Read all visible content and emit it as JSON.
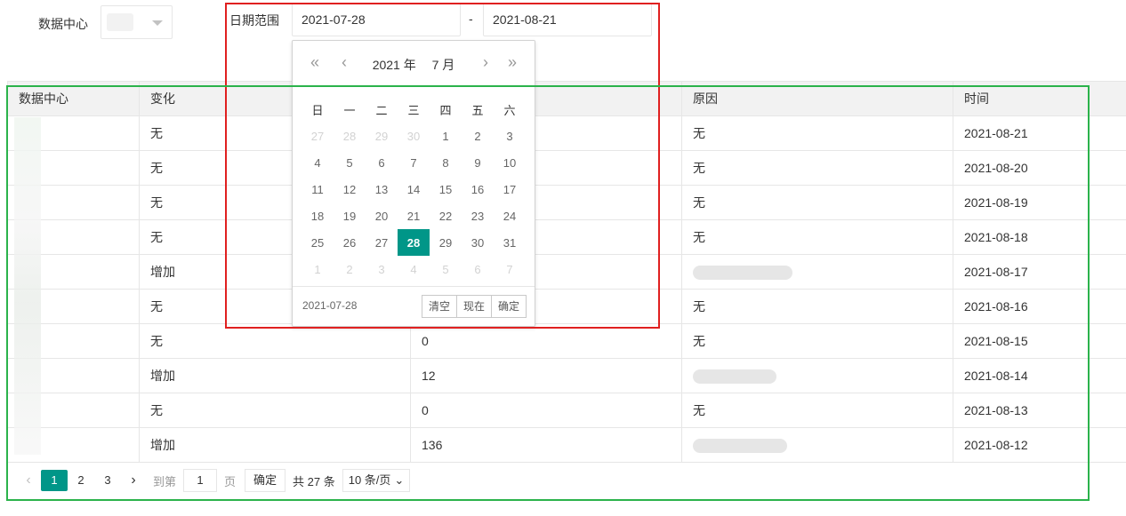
{
  "filters": {
    "datacenter_label": "数据中心",
    "range_label": "日期范围",
    "start_date": "2021-07-28",
    "separator": "-",
    "end_date": "2021-08-21"
  },
  "table": {
    "headers": [
      "数据中心",
      "变化",
      "",
      "原因",
      "时间"
    ],
    "rows": [
      {
        "change": "无",
        "count": "",
        "reason": "无",
        "time": "2021-08-21"
      },
      {
        "change": "无",
        "count": "",
        "reason": "无",
        "time": "2021-08-20"
      },
      {
        "change": "无",
        "count": "",
        "reason": "无",
        "time": "2021-08-19"
      },
      {
        "change": "无",
        "count": "",
        "reason": "无",
        "time": "2021-08-18"
      },
      {
        "change": "增加",
        "count": "",
        "reason": "",
        "time": "2021-08-17"
      },
      {
        "change": "无",
        "count": "",
        "reason": "无",
        "time": "2021-08-16"
      },
      {
        "change": "无",
        "count": "0",
        "reason": "无",
        "time": "2021-08-15"
      },
      {
        "change": "增加",
        "count": "12",
        "reason": "",
        "time": "2021-08-14"
      },
      {
        "change": "无",
        "count": "0",
        "reason": "无",
        "time": "2021-08-13"
      },
      {
        "change": "增加",
        "count": "136",
        "reason": "",
        "time": "2021-08-12"
      }
    ]
  },
  "pagination": {
    "pages": [
      "1",
      "2",
      "3"
    ],
    "goto_label": "到第",
    "goto_value": "1",
    "page_label": "页",
    "confirm": "确定",
    "total": "共 27 条",
    "page_size": "10 条/页"
  },
  "picker": {
    "year": "2021 年",
    "month": "7 月",
    "weekdays": [
      "日",
      "一",
      "二",
      "三",
      "四",
      "五",
      "六"
    ],
    "weeks": [
      [
        "27",
        "28",
        "29",
        "30",
        "1",
        "2",
        "3"
      ],
      [
        "4",
        "5",
        "6",
        "7",
        "8",
        "9",
        "10"
      ],
      [
        "11",
        "12",
        "13",
        "14",
        "15",
        "16",
        "17"
      ],
      [
        "18",
        "19",
        "20",
        "21",
        "22",
        "23",
        "24"
      ],
      [
        "25",
        "26",
        "27",
        "28",
        "29",
        "30",
        "31"
      ],
      [
        "1",
        "2",
        "3",
        "4",
        "5",
        "6",
        "7"
      ]
    ],
    "selected_date": "2021-07-28",
    "clear": "清空",
    "now": "现在",
    "ok": "确定"
  },
  "colors": {
    "accent": "#009688",
    "highlight_red": "#e02020",
    "highlight_green": "#2bb34b"
  }
}
